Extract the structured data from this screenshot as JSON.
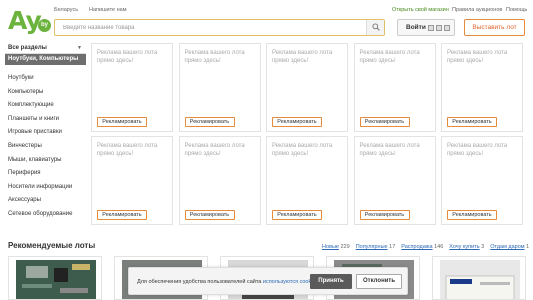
{
  "topbar": {
    "left_links": [
      "Беларусь",
      "Напишите нам"
    ],
    "right_links": [
      "Открыть свой магазин",
      "Правила аукционов",
      "Помощь"
    ]
  },
  "logo": {
    "text": "Ay",
    "badge": "by",
    "brand_color": "#6cb33e"
  },
  "search": {
    "placeholder": "Введите название товара",
    "value": "",
    "icon": "search-icon"
  },
  "header": {
    "login_label": "Войти",
    "social_icons": [
      "vk-icon",
      "ok-icon",
      "fb-icon"
    ],
    "sell_label": "Выставить лот",
    "accent_color": "#e68a3c"
  },
  "sidebar": {
    "heading": "Все разделы",
    "active": "Ноутбуки, Компьютеры",
    "items": [
      "Ноутбуки",
      "Компьютеры",
      "Комплектующие",
      "Планшеты и книги",
      "Игровые приставки",
      "Винчестеры",
      "Мыши, клавиатуры",
      "Периферия",
      "Носители информации",
      "Аксессуары",
      "Сетевое оборудование"
    ]
  },
  "ads": {
    "text": "Реклама вашего лота прямо здесь!",
    "button_label": "Рекламировать",
    "count": 10
  },
  "recommended": {
    "title": "Рекомендуемые лоты",
    "tabs": [
      {
        "name": "Новые",
        "count": "229"
      },
      {
        "name": "Популярные",
        "count": "17"
      },
      {
        "name": "Распродажа",
        "count": "146"
      },
      {
        "name": "Хочу купить",
        "count": "3"
      },
      {
        "name": "Отдам даром",
        "count": "1"
      }
    ]
  },
  "cookie": {
    "text": "Для обеспечения удобства пользователей сайта ",
    "link": "используются cookies",
    "accept_label": "Принять",
    "decline_label": "Отклонить"
  }
}
